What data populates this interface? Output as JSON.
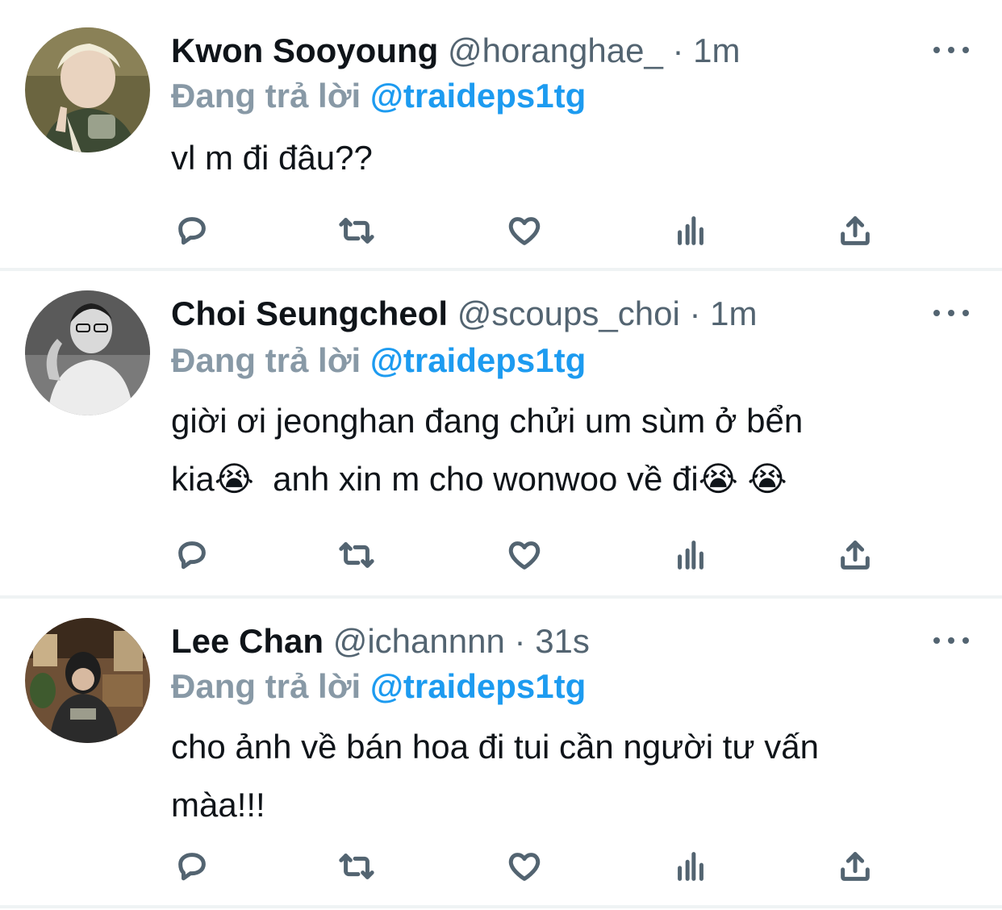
{
  "tweets": [
    {
      "name": "Kwon Sooyoung",
      "handle": "@horanghae_",
      "separator": "·",
      "time": "1m",
      "reply_prefix": "Đang trả lời",
      "reply_to": "@traideps1tg",
      "text": "vl m đi đâu??",
      "avatar_icon": "avatar-photo"
    },
    {
      "name": "Choi Seungcheol",
      "handle": "@scoups_choi",
      "separator": "·",
      "time": "1m",
      "reply_prefix": "Đang trả lời",
      "reply_to": "@traideps1tg",
      "text": "giời ơi jeonghan đang chửi um sùm ở bển\nkia😭  anh xin m cho wonwoo về đi😭 😭",
      "avatar_icon": "avatar-photo"
    },
    {
      "name": "Lee Chan",
      "handle": "@ichannnn",
      "separator": "·",
      "time": "31s",
      "reply_prefix": "Đang trả lời",
      "reply_to": "@traideps1tg",
      "text": "cho ảnh về bán hoa đi tui cần người tư vấn\nmàa!!!",
      "avatar_icon": "avatar-photo"
    }
  ],
  "action_icons": [
    "reply-icon",
    "retweet-icon",
    "like-icon",
    "views-icon",
    "share-icon"
  ],
  "colors": {
    "link": "#1d9bf0",
    "reply_prefix": "#8899a6",
    "meta": "#536471",
    "text": "#0f1419",
    "divider": "#eff3f4"
  }
}
